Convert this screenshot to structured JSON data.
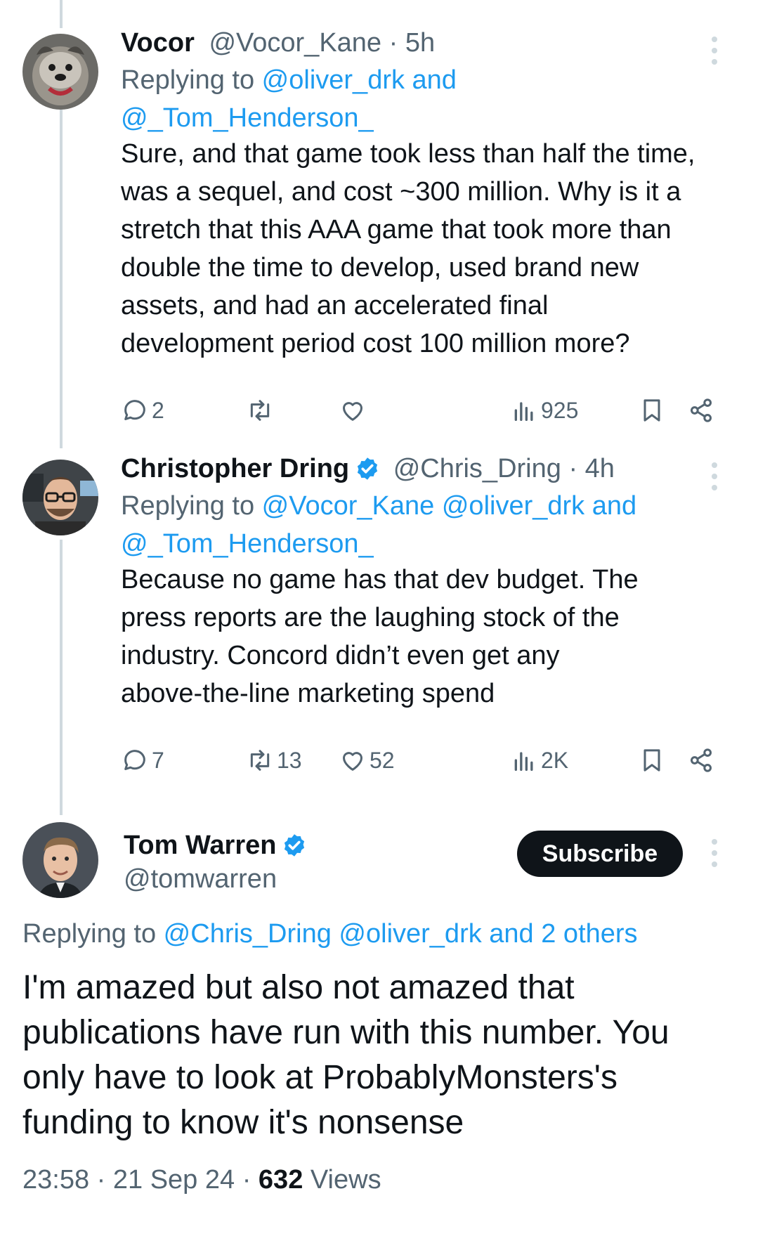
{
  "tweets": [
    {
      "name": "Vocor",
      "handle": "@Vocor_Kane",
      "time_sep": " · ",
      "time": "5h",
      "replying_prefix": "Replying to ",
      "replying_line1": "@oliver_drk and",
      "replying_line2": "@_Tom_Henderson_",
      "body": [
        "Sure, and that game took less than half the time,",
        "was a sequel, and cost ~300 million. Why is it a",
        "stretch that this AAA game that took more than",
        "double the time  to develop, used brand new",
        "assets, and had an accelerated final",
        "development period cost 100 million more?"
      ],
      "replies": "2",
      "retweets": "",
      "likes": "",
      "views": "925",
      "avatar_icon": "dog-avatar"
    },
    {
      "name": "Christopher Dring",
      "handle": "@Chris_Dring",
      "time_sep": " · ",
      "time": "4h",
      "replying_prefix": "Replying to ",
      "replying_line1": "@Vocor_Kane @oliver_drk and",
      "replying_line2": "@_Tom_Henderson_",
      "body": [
        "Because no game has that dev budget. The",
        "press reports are the laughing stock of the",
        "industry. Concord didn’t even get any",
        "above-the-line marketing spend"
      ],
      "replies": "7",
      "retweets": "13",
      "likes": "52",
      "views": "2K",
      "verified": true,
      "avatar_icon": "man-glasses-avatar"
    }
  ],
  "main_tweet": {
    "name": "Tom Warren",
    "handle": "@tomwarren",
    "verified": true,
    "subscribe_label": "Subscribe",
    "replying_prefix": "Replying to ",
    "replying_links": "@Chris_Dring @oliver_drk and 2 others",
    "body": [
      "I'm amazed but also not amazed that",
      "publications have run with this number. You",
      "only have to look at ProbablyMonsters's",
      "funding to know it's nonsense"
    ],
    "time": "23:58",
    "date": "21 Sep 24",
    "sep": " · ",
    "views_count": "632",
    "views_label": " Views",
    "avatar_icon": "man-avatar"
  },
  "colors": {
    "accent": "#1d9bf0",
    "muted": "#536471",
    "text": "#0f1419",
    "thread_line": "#cfd9de"
  }
}
